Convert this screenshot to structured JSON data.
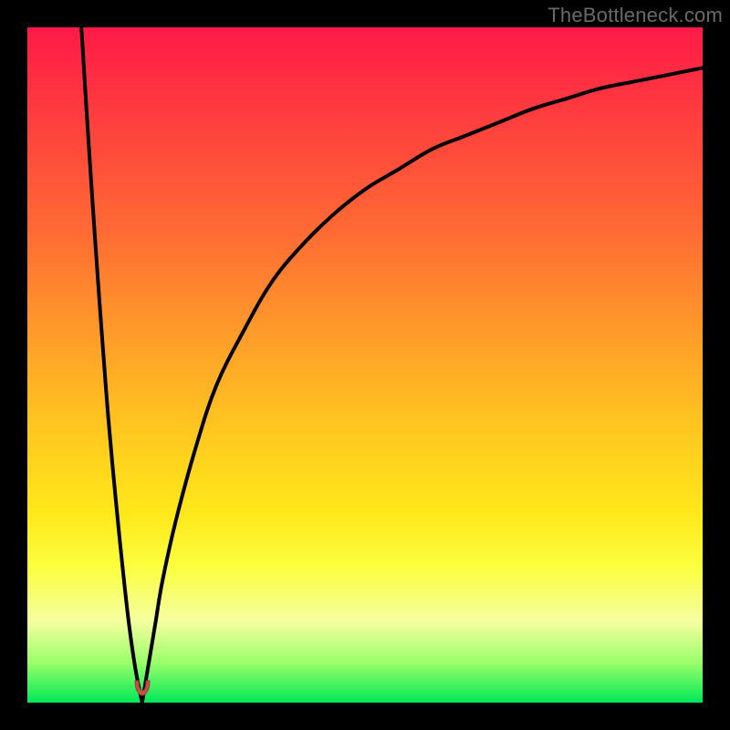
{
  "watermark": "TheBottleneck.com",
  "colors": {
    "frame": "#000000",
    "gradient_top": "#ff1a47",
    "gradient_mid": "#ffe81a",
    "gradient_bottom": "#00e858",
    "curve": "#000000",
    "marker": "#c25247"
  },
  "chart_data": {
    "type": "line",
    "title": "",
    "xlabel": "",
    "ylabel": "",
    "xlim": [
      0,
      100
    ],
    "ylim": [
      0,
      100
    ],
    "annotations": [
      {
        "name": "optimal-marker",
        "x": 17,
        "y": 0
      }
    ],
    "series": [
      {
        "name": "left-branch",
        "x": [
          8,
          9,
          10,
          11,
          12,
          13,
          14,
          15,
          16,
          17
        ],
        "values": [
          100,
          84,
          69,
          55,
          42,
          31,
          21,
          12,
          5,
          0
        ]
      },
      {
        "name": "right-branch",
        "x": [
          17,
          18,
          19,
          20,
          22,
          25,
          28,
          32,
          36,
          40,
          45,
          50,
          55,
          60,
          65,
          70,
          75,
          80,
          85,
          90,
          95,
          100
        ],
        "values": [
          0,
          6,
          12,
          18,
          27,
          38,
          47,
          55,
          62,
          67,
          72,
          76,
          79,
          82,
          84,
          86,
          88,
          89.5,
          91,
          92,
          93,
          94
        ]
      }
    ]
  }
}
